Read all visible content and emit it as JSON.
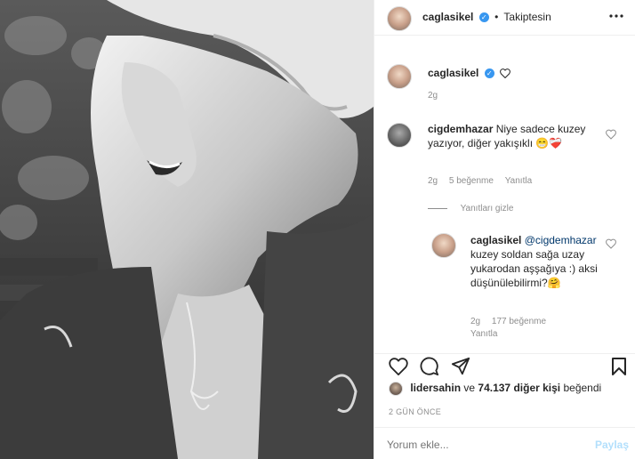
{
  "post": {
    "image_alt_icon": "photo-icon",
    "author": {
      "username": "caglasikel",
      "verified": true,
      "follow_status": "Takiptesin"
    },
    "caption": {
      "username": "caglasikel",
      "time": "2g"
    }
  },
  "comments": [
    {
      "username": "cigdemhazar",
      "text": "Niye sadece kuzey yazıyor, diğer yakışıklı 😁❤️‍🩹",
      "time": "2g",
      "likes": "5 beğenme",
      "reply_label": "Yanıtla",
      "hide_replies_label": "Yanıtları gizle",
      "replies": [
        {
          "username": "caglasikel",
          "mention": "@cigdemhazar",
          "text": "kuzey soldan sağa uzay yukarodan aşşağıya :) aksi düşünülebilirmi?🤗",
          "time": "2g",
          "likes": "177 beğenme",
          "reply_label": "Yanıtla"
        }
      ]
    }
  ],
  "likes_summary": {
    "user": "lidersahin",
    "connector": "ve",
    "count": "74.137 diğer kişi",
    "suffix": "beğendi"
  },
  "timestamp": "2 GÜN ÖNCE",
  "add_comment": {
    "placeholder": "Yorum ekle...",
    "post_label": "Paylaş"
  },
  "colors": {
    "accent": "#3897f0",
    "verified": "#3897f0",
    "muted": "#8e8e8e",
    "post_disabled": "#b2dffc"
  }
}
